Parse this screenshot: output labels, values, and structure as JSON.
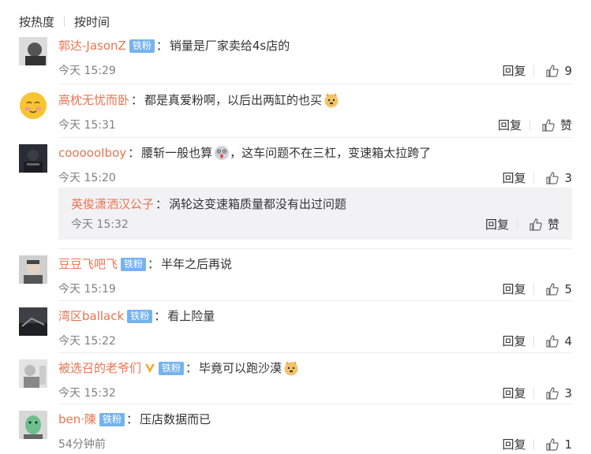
{
  "sort": {
    "hot": "按热度",
    "time": "按时间"
  },
  "comments": [
    {
      "name": "郭达-JasonZ",
      "badge": "铁粉",
      "text": "销量是厂家卖给4s店的",
      "time": "今天 15:29",
      "reply": "回复",
      "likes": "9"
    },
    {
      "name": "高枕无忧而卧",
      "text": "都是真爱粉啊，以后出两缸的也买",
      "emoji": "doge-emoji",
      "time": "今天 15:31",
      "reply": "回复",
      "likes": "赞"
    },
    {
      "name": "coooooIboy",
      "text1": "腰斩一般也算",
      "emoji": "surprised-emoji",
      "text2": "，这车问题不在三杠，变速箱太拉跨了",
      "time": "今天 15:20",
      "reply": "回复",
      "likes": "3"
    },
    {
      "name": "豆豆飞吧飞",
      "badge": "铁粉",
      "text": "半年之后再说",
      "time": "今天 15:19",
      "reply": "回复",
      "likes": "5"
    },
    {
      "name": "湾区ballack",
      "badge": "铁粉",
      "text": "看上险量",
      "time": "今天 15:22",
      "reply": "回复",
      "likes": "4"
    },
    {
      "name": "被选召的老爷们",
      "vip": "vip-v-icon",
      "badge": "铁粉",
      "text": "毕竟可以跑沙漠",
      "emoji": "doge-emoji",
      "time": "今天 15:32",
      "reply": "回复",
      "likes": "3"
    },
    {
      "name": "ben·陳",
      "badge": "铁粉",
      "text": "压店数据而已",
      "time": "54分钟前",
      "reply": "回复",
      "likes": "1"
    }
  ],
  "sub_reply": {
    "name": "英俊潇洒汉公子",
    "text": "涡轮这变速箱质量都没有出过问题",
    "time": "今天 15:32",
    "reply": "回复",
    "likes": "赞"
  },
  "colors": {
    "name": "#eb7350",
    "badge": "#75b3ee",
    "time": "#808080"
  }
}
